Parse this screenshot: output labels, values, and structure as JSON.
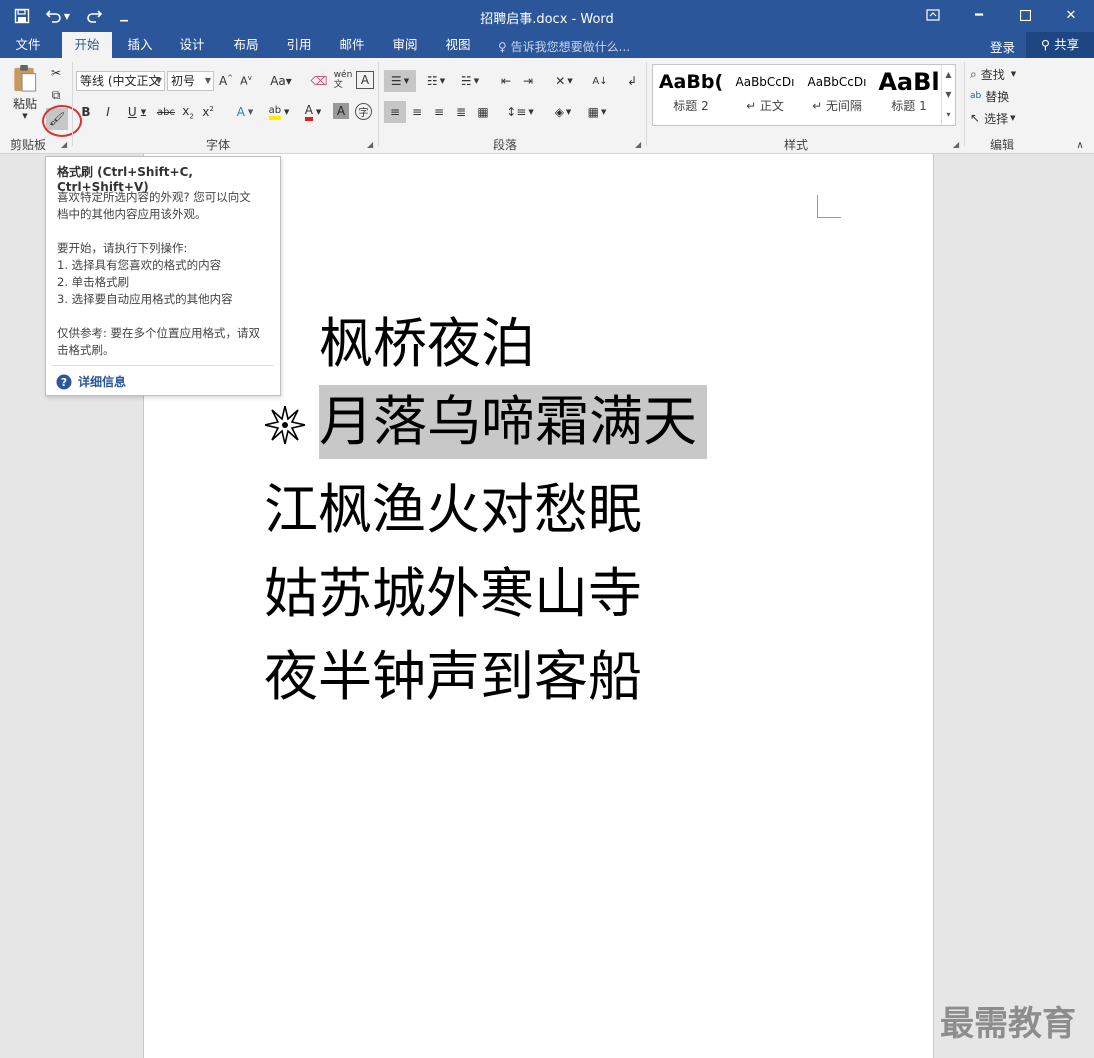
{
  "window": {
    "title": "招聘启事.docx - Word"
  },
  "tabs": [
    {
      "label": "文件"
    },
    {
      "label": "开始"
    },
    {
      "label": "插入"
    },
    {
      "label": "设计"
    },
    {
      "label": "布局"
    },
    {
      "label": "引用"
    },
    {
      "label": "邮件"
    },
    {
      "label": "审阅"
    },
    {
      "label": "视图"
    }
  ],
  "tellme": "告诉我您想要做什么...",
  "account": {
    "login": "登录",
    "share": "共享"
  },
  "clipboard": {
    "paste": "粘贴",
    "label": "剪贴板"
  },
  "font": {
    "name": "等线 (中文正文",
    "size": "初号",
    "label": "字体"
  },
  "paragraph": {
    "label": "段落"
  },
  "styles": {
    "label": "样式",
    "items": [
      {
        "preview": "AaBb(",
        "name": "标题 2"
      },
      {
        "preview": "AaBbCcDı",
        "name": "↵ 正文"
      },
      {
        "preview": "AaBbCcDı",
        "name": "↵ 无间隔"
      },
      {
        "preview": "AaBl",
        "name": "标题 1"
      }
    ]
  },
  "editing": {
    "find": "查找",
    "replace": "替换",
    "select": "选择",
    "label": "编辑"
  },
  "tooltip": {
    "title": "格式刷 (Ctrl+Shift+C, Ctrl+Shift+V)",
    "p1a": "喜欢特定所选内容的外观? 您可以向文",
    "p1b": "档中的其他内容应用该外观。",
    "p2": "要开始，请执行下列操作:",
    "step1": "1. 选择具有您喜欢的格式的内容",
    "step2": "2. 单击格式刷",
    "step3": "3. 选择要自动应用格式的其他内容",
    "p3a": "仅供参考: 要在多个位置应用格式，请双",
    "p3b": "击格式刷。",
    "more": "详细信息"
  },
  "document": {
    "lines": [
      "枫桥夜泊",
      "月落乌啼霜满天",
      "江枫渔火对愁眠",
      "姑苏城外寒山寺",
      "夜半钟声到客船"
    ]
  },
  "watermark": "最需教育"
}
